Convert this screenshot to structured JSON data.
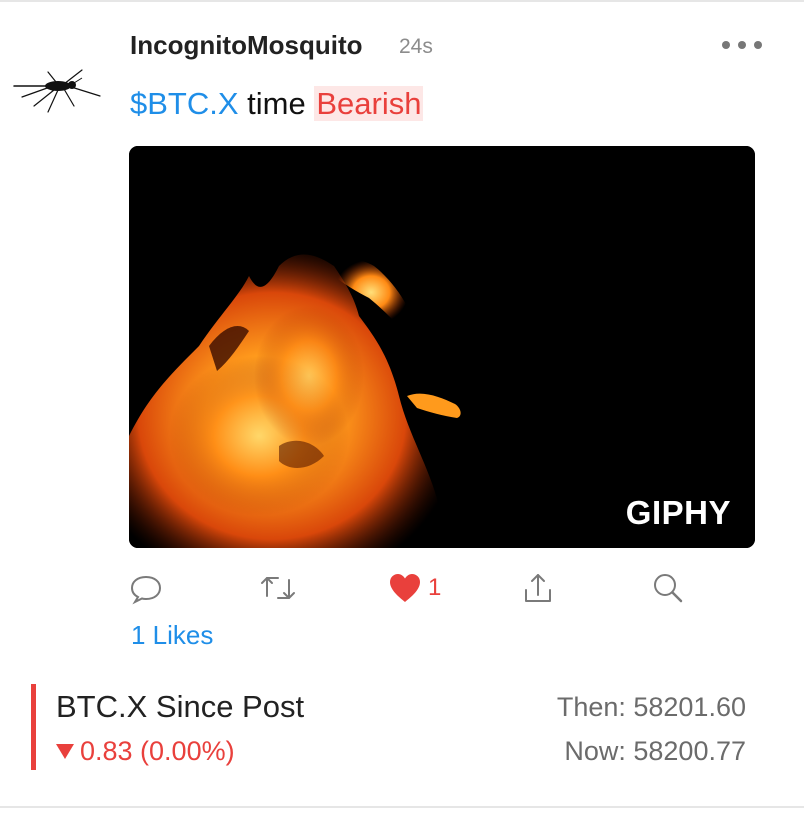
{
  "post": {
    "username": "IncognitoMosquito",
    "timestamp": "24s",
    "cashtag": "$BTC.X",
    "body_text": "time",
    "sentiment": "Bearish",
    "media_watermark": "GIPHY",
    "like_count": "1",
    "likes_link": "1 Likes"
  },
  "icons": [
    "more-icon",
    "comment-icon",
    "reshare-icon",
    "heart-icon",
    "share-icon",
    "search-icon"
  ],
  "ticker": {
    "title": "BTC.X Since Post",
    "change": "0.83 (0.00%)",
    "then": "Then: 58201.60",
    "now": "Now: 58200.77"
  },
  "colors": {
    "link_blue": "#1f8ee8",
    "bearish_red": "#e9403c",
    "bearish_bg": "#fde7e6",
    "muted_gray": "#6b6b6b"
  }
}
